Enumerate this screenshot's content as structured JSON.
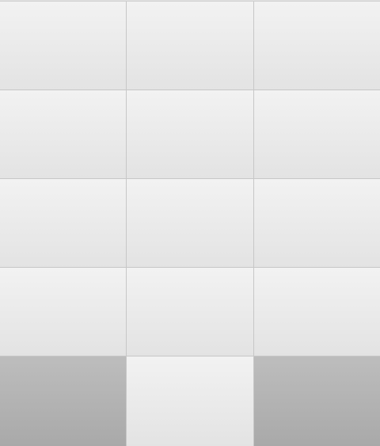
{
  "keypad": {
    "rows": [
      [
        "",
        "",
        ""
      ],
      [
        "",
        "",
        ""
      ],
      [
        "",
        "",
        ""
      ],
      [
        "",
        "",
        ""
      ],
      [
        "",
        "",
        ""
      ]
    ],
    "dark_keys": [
      [
        4,
        0
      ],
      [
        4,
        2
      ]
    ],
    "colors": {
      "light_key_top": "#f2f2f2",
      "light_key_bottom": "#e3e3e3",
      "dark_key_top": "#bdbdbd",
      "dark_key_bottom": "#a9a9a9",
      "divider": "#c7c7c7"
    }
  }
}
